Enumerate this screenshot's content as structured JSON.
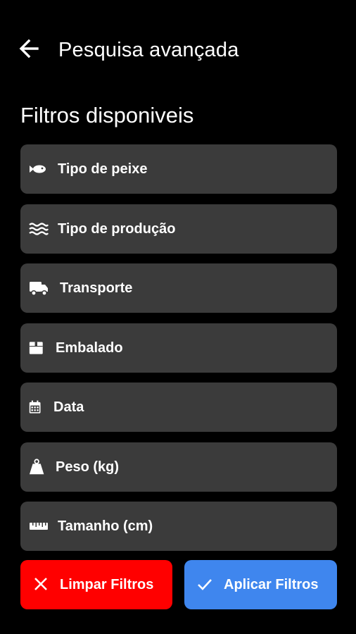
{
  "header": {
    "title": "Pesquisa avançada",
    "back_icon": "arrow-left-icon"
  },
  "section_title": "Filtros disponiveis",
  "filters": [
    {
      "label": "Tipo de peixe",
      "icon": "fish-icon"
    },
    {
      "label": "Tipo de produção",
      "icon": "water-waves-icon"
    },
    {
      "label": "Transporte",
      "icon": "truck-icon"
    },
    {
      "label": "Embalado",
      "icon": "box-icon"
    },
    {
      "label": "Data",
      "icon": "calendar-icon"
    },
    {
      "label": "Peso (kg)",
      "icon": "weight-icon"
    },
    {
      "label": "Tamanho (cm)",
      "icon": "ruler-icon"
    }
  ],
  "buttons": {
    "clear": {
      "label": "Limpar Filtros",
      "icon": "close-icon",
      "color": "#ff0000"
    },
    "apply": {
      "label": "Aplicar Filtros",
      "icon": "check-icon",
      "color": "#3f86ee"
    }
  },
  "colors": {
    "background": "#000000",
    "card": "#3b3b3b",
    "text": "#ffffff"
  }
}
